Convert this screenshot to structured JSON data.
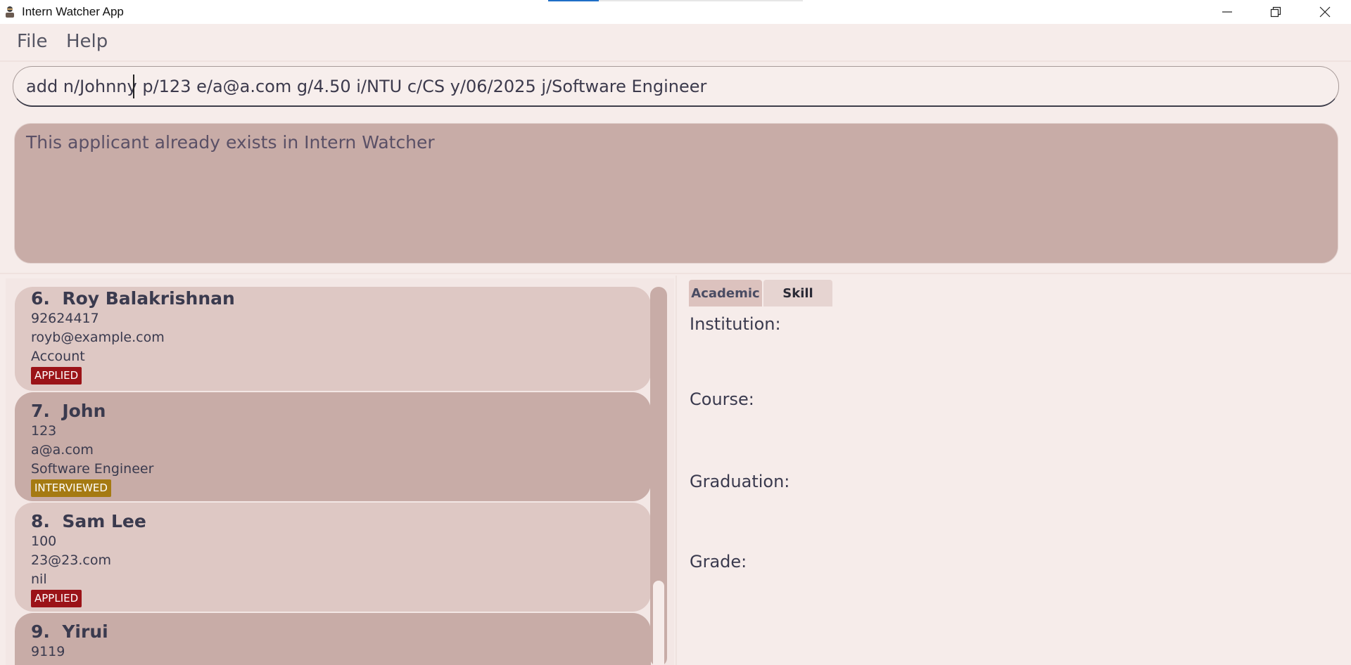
{
  "window": {
    "title": "Intern Watcher App",
    "controls": {
      "minimize": "minimize-icon",
      "restore": "restore-icon",
      "close": "close-icon"
    }
  },
  "menu": {
    "file_label": "File",
    "help_label": "Help"
  },
  "command": {
    "value": "add n/Johnny p/123 e/a@a.com g/4.50 i/NTU c/CS y/06/2025 j/Software Engineer"
  },
  "result": {
    "message": "This applicant already exists in Intern Watcher"
  },
  "applicants": [
    {
      "index": "6.",
      "name": "Roy Balakrishnan",
      "phone": "92624417",
      "email": "royb@example.com",
      "job": "Account",
      "status": "APPLIED"
    },
    {
      "index": "7.",
      "name": "John",
      "phone": "123",
      "email": "a@a.com",
      "job": "Software Engineer",
      "status": "INTERVIEWED"
    },
    {
      "index": "8.",
      "name": "Sam Lee",
      "phone": "100",
      "email": "23@23.com",
      "job": "nil",
      "status": "APPLIED"
    },
    {
      "index": "9.",
      "name": "Yirui",
      "phone": "9119"
    }
  ],
  "detail": {
    "tabs": [
      "Academic",
      "Skill"
    ],
    "fields": {
      "institution": "Institution:",
      "course": "Course:",
      "graduation": "Graduation:",
      "grade": "Grade:"
    }
  },
  "colors": {
    "background": "#f6ecea",
    "card_light": "#dec8c4",
    "card_dark": "#c8aca7",
    "applied": "#9b1318",
    "interviewed": "#a57a12"
  }
}
